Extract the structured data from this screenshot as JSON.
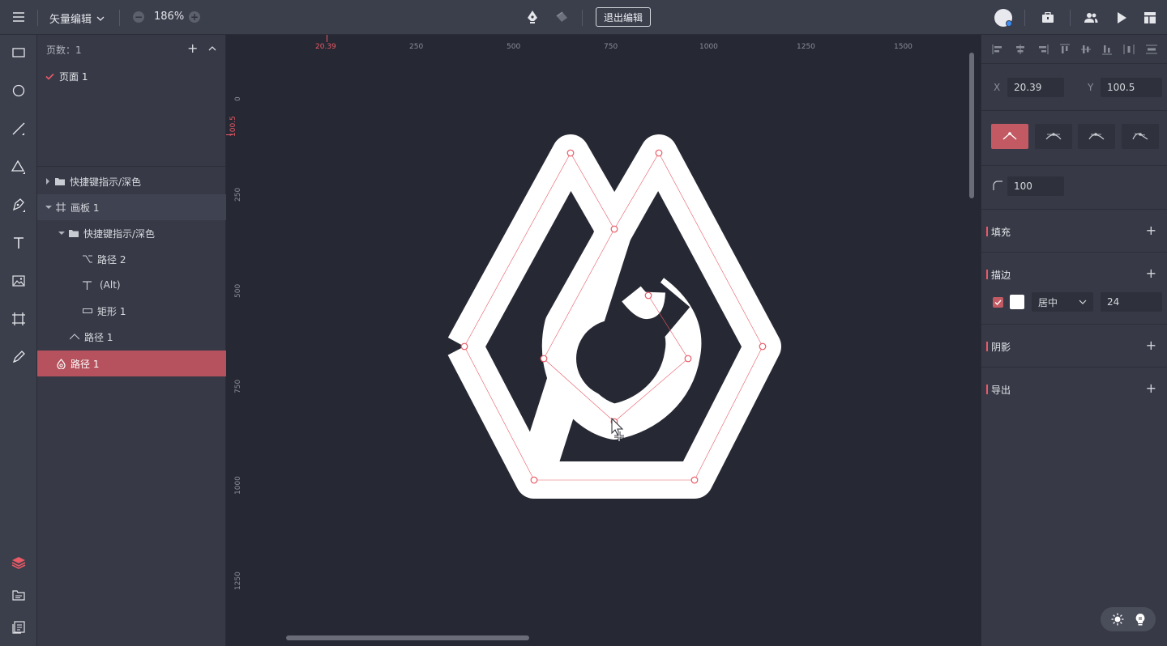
{
  "topbar": {
    "mode_label": "矢量编辑",
    "zoom": "186%",
    "zoom_minus": "−",
    "zoom_plus": "+",
    "exit_label": "退出编辑"
  },
  "pages": {
    "header": "页数：1",
    "add_symbol": "+",
    "items": [
      {
        "label": "页面 1"
      }
    ]
  },
  "layers": [
    {
      "label": "快捷键指示/深色",
      "icon": "folder-icon"
    },
    {
      "label": "画板 1",
      "icon": "artboard-icon"
    },
    {
      "label": "快捷键指示/深色",
      "icon": "folder-icon"
    },
    {
      "label": "路径 2",
      "icon": "path-icon"
    },
    {
      "label": "(Alt)",
      "icon": "text-icon"
    },
    {
      "label": "矩形 1",
      "icon": "rect-icon"
    },
    {
      "label": "路径 1",
      "icon": "path-icon"
    },
    {
      "label": "路径 1",
      "icon": "drop-icon",
      "selected": true
    }
  ],
  "ruler": {
    "h_marker": "20.39",
    "h_ticks": [
      "250",
      "500",
      "750",
      "1000",
      "1250",
      "1500"
    ],
    "v_marker": "100.5",
    "v_ticks": [
      "0",
      "250",
      "500",
      "750",
      "1000",
      "1250"
    ]
  },
  "props": {
    "x_label": "X",
    "x_value": "20.39",
    "y_label": "Y",
    "y_value": "100.5",
    "radius_value": "100",
    "sections": {
      "fill": "填充",
      "stroke": "描边",
      "shadow": "阴影",
      "export": "导出"
    },
    "plus": "+",
    "stroke_align": "居中",
    "stroke_width": "24"
  },
  "colors": {
    "accent": "#e85a66",
    "selected_row": "#b5525d",
    "canvas_bg": "#262833",
    "shape": "#ffffff"
  }
}
